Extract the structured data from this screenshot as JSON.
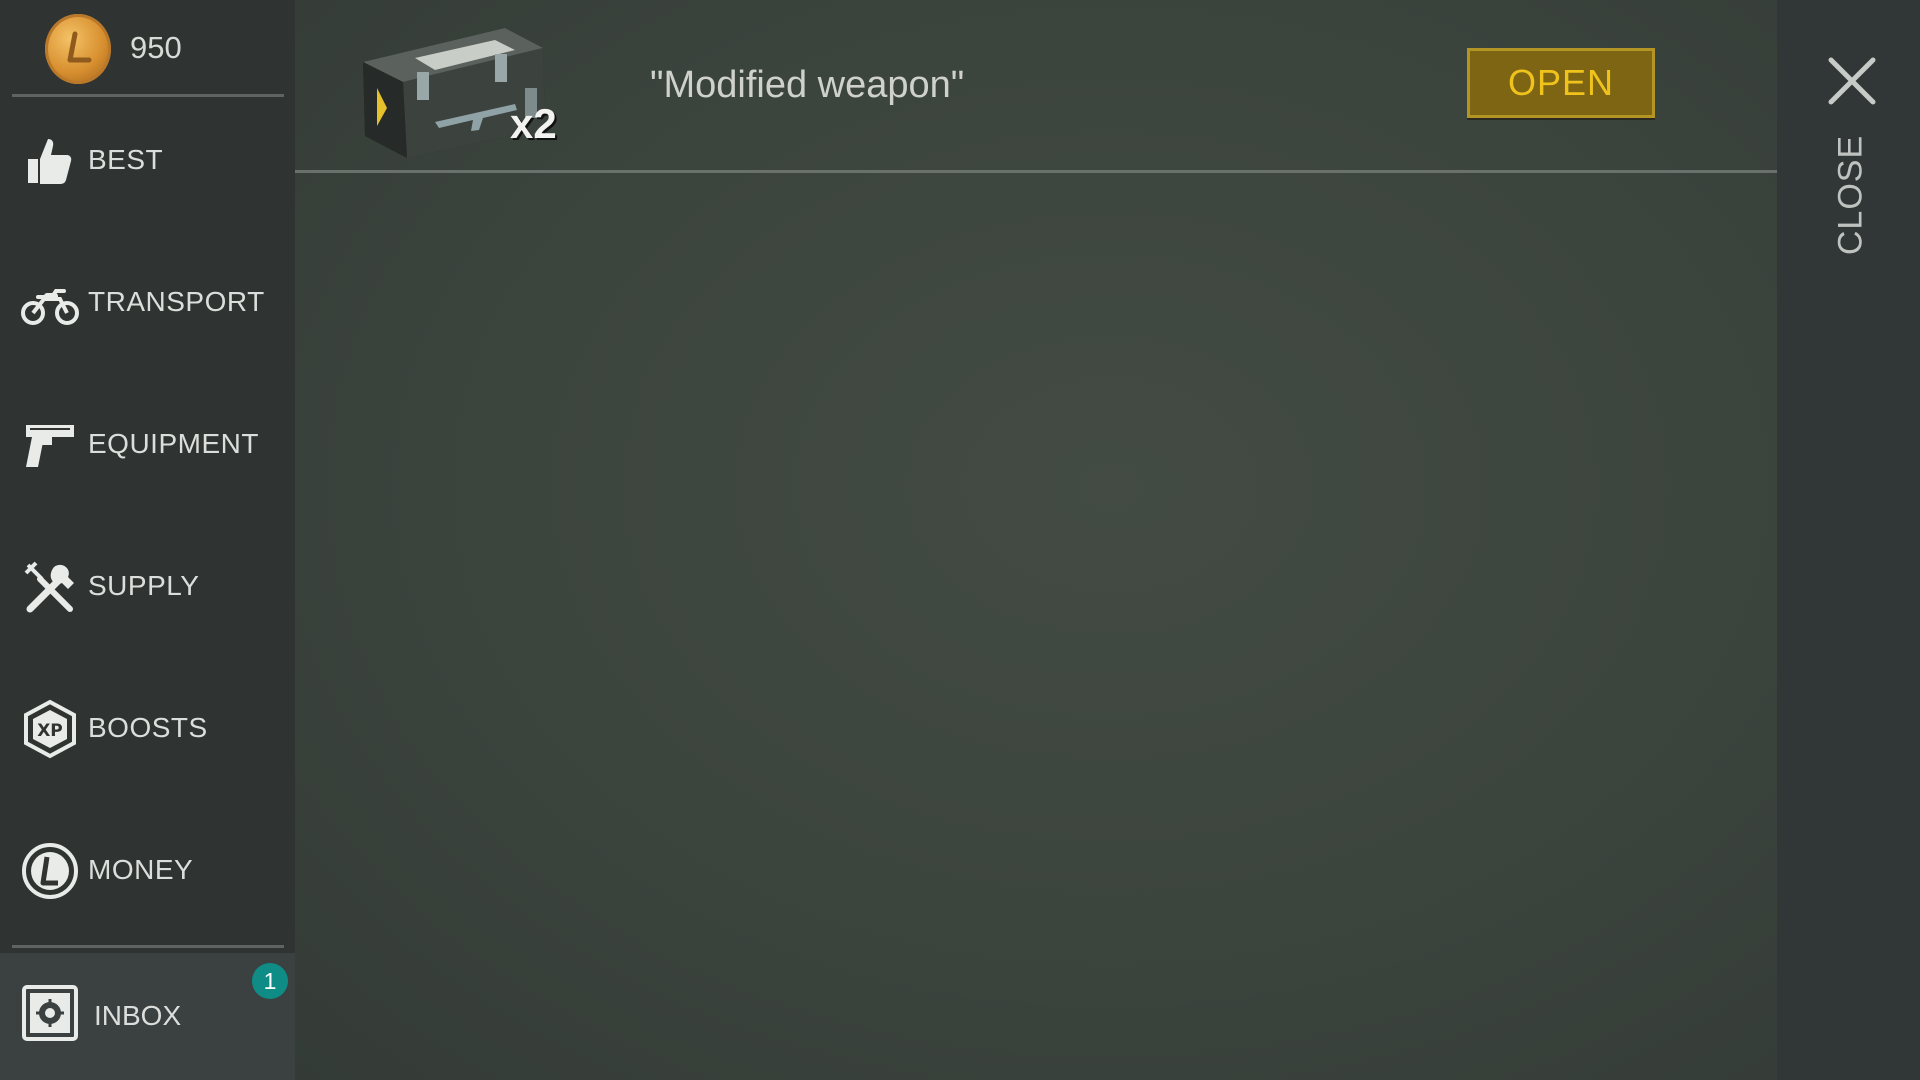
{
  "currency": {
    "amount": "950",
    "icon": "coin-icon"
  },
  "sidebar": {
    "items": [
      {
        "label": "BEST",
        "icon": "thumbs-up-icon"
      },
      {
        "label": "TRANSPORT",
        "icon": "motorcycle-icon"
      },
      {
        "label": "EQUIPMENT",
        "icon": "pistol-icon"
      },
      {
        "label": "SUPPLY",
        "icon": "tools-icon"
      },
      {
        "label": "BOOSTS",
        "icon": "xp-icon"
      },
      {
        "label": "MONEY",
        "icon": "money-icon"
      }
    ],
    "inbox": {
      "label": "INBOX",
      "badge": "1",
      "icon": "safe-icon"
    }
  },
  "offer": {
    "title": "\"Modified weapon\"",
    "count": "x2",
    "button_label": "OPEN"
  },
  "close": {
    "label": "CLOSE"
  },
  "colors": {
    "accent_gold": "#f0c21c",
    "button_bg": "#7d6514",
    "badge_teal": "#0f8c86",
    "sidebar_bg": "#2f3433"
  }
}
